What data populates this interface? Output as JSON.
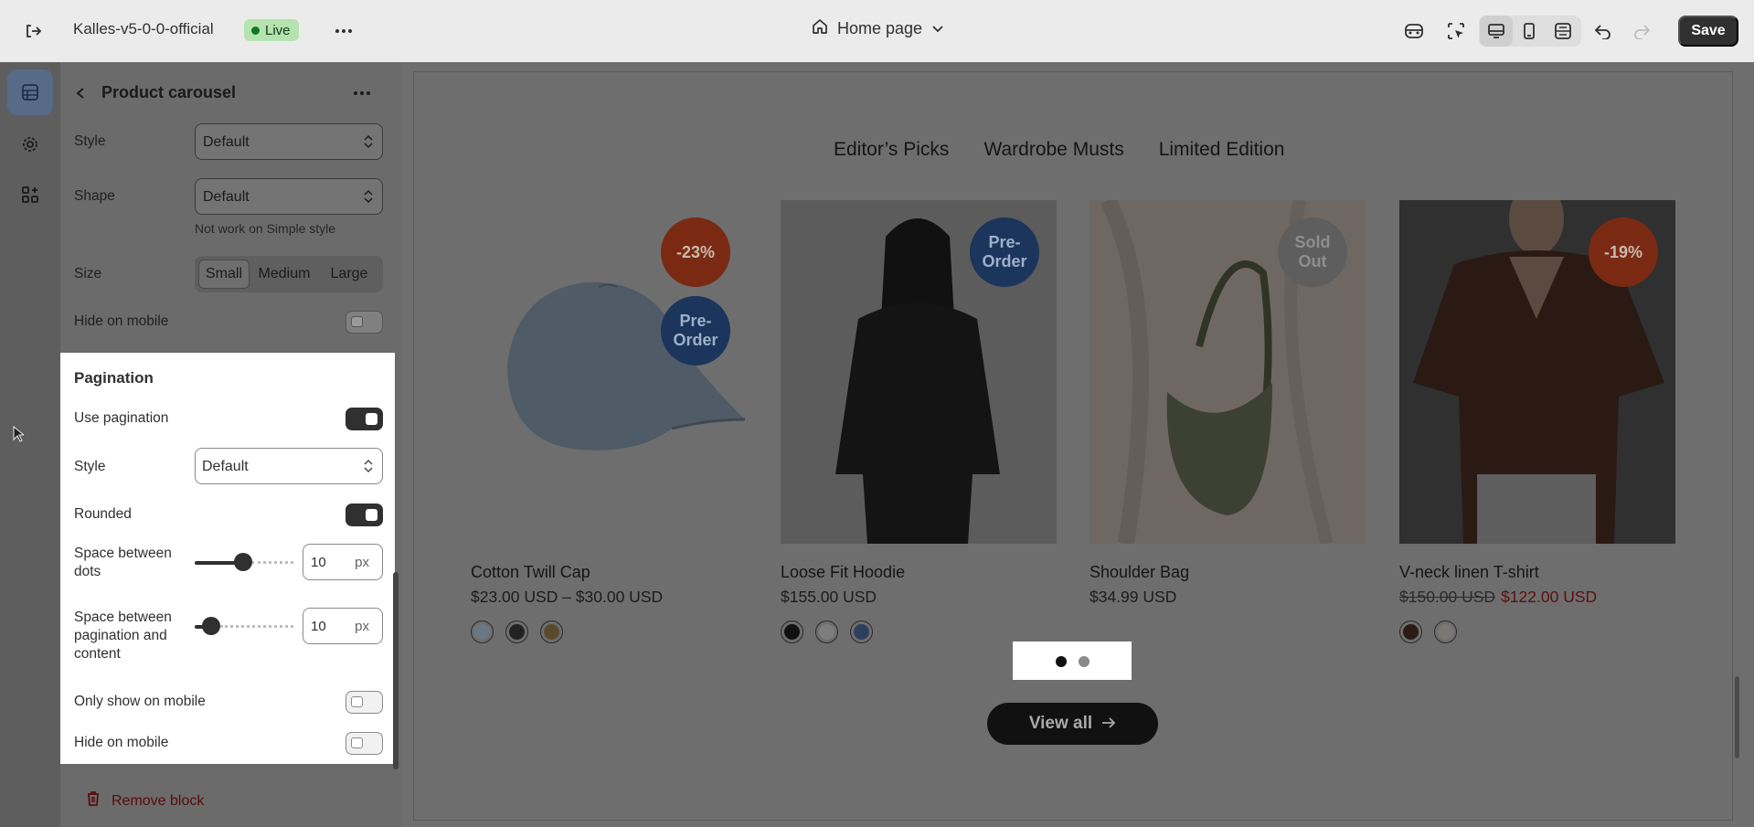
{
  "topbar": {
    "store_name": "Kalles-v5-0-0-official",
    "live_label": "Live",
    "page_name": "Home page",
    "save_label": "Save",
    "icons": [
      "exit-icon",
      "more-icon",
      "home-icon",
      "chevron-down-icon",
      "preview-icon",
      "inspector-icon",
      "desktop-icon",
      "mobile-icon",
      "fullwidth-icon",
      "undo-icon",
      "redo-icon"
    ]
  },
  "rail": {
    "icons": [
      "sections-icon",
      "settings-icon",
      "apps-icon"
    ]
  },
  "panel": {
    "title": "Product carousel",
    "style_label": "Style",
    "style_value": "Default",
    "shape_label": "Shape",
    "shape_value": "Default",
    "shape_hint": "Not work on Simple style",
    "size_label": "Size",
    "size_options": [
      "Small",
      "Medium",
      "Large"
    ],
    "size_selected": "Small",
    "hide_mobile_label": "Hide on mobile",
    "hide_mobile_on": false
  },
  "pagination": {
    "title": "Pagination",
    "use_label": "Use pagination",
    "use_on": true,
    "style_label": "Style",
    "style_value": "Default",
    "rounded_label": "Rounded",
    "rounded_on": true,
    "dots_space_label": "Space between dots",
    "dots_space_value": "10",
    "dots_space_unit": "px",
    "content_space_label": "Space between pagination and content",
    "content_space_value": "10",
    "content_space_unit": "px",
    "only_mobile_label": "Only show on mobile",
    "only_mobile_on": false,
    "hide_mobile_label": "Hide on mobile",
    "hide_mobile_on": false
  },
  "remove_block_label": "Remove block",
  "preview": {
    "tabs": [
      "Editor’s Picks",
      "Wardrobe Musts",
      "Limited Edition"
    ],
    "products": [
      {
        "name": "Cotton Twill Cap",
        "price": "$23.00 USD – $30.00 USD",
        "badges": [
          "-23%",
          "Pre-\nOrder"
        ],
        "swatches": [
          "#b6c8d6",
          "#222222",
          "#7a6a4a"
        ]
      },
      {
        "name": "Loose Fit Hoodie",
        "price": "$155.00 USD",
        "badges": [
          "Pre-\nOrder"
        ],
        "swatches": [
          "#111111",
          "#d9d9d9",
          "#3f5f9a"
        ]
      },
      {
        "name": "Shoulder Bag",
        "price": "$34.99 USD",
        "badges": [
          "Sold\nOut"
        ],
        "swatches": []
      },
      {
        "name": "V-neck linen T-shirt",
        "old_price": "$150.00 USD",
        "sale_price": "$122.00 USD",
        "badges": [
          "-19%"
        ],
        "swatches": [
          "#3d2a22",
          "#e6e1da"
        ]
      }
    ],
    "view_all_label": "View all",
    "active_dot": 1,
    "dot_count": 2
  }
}
